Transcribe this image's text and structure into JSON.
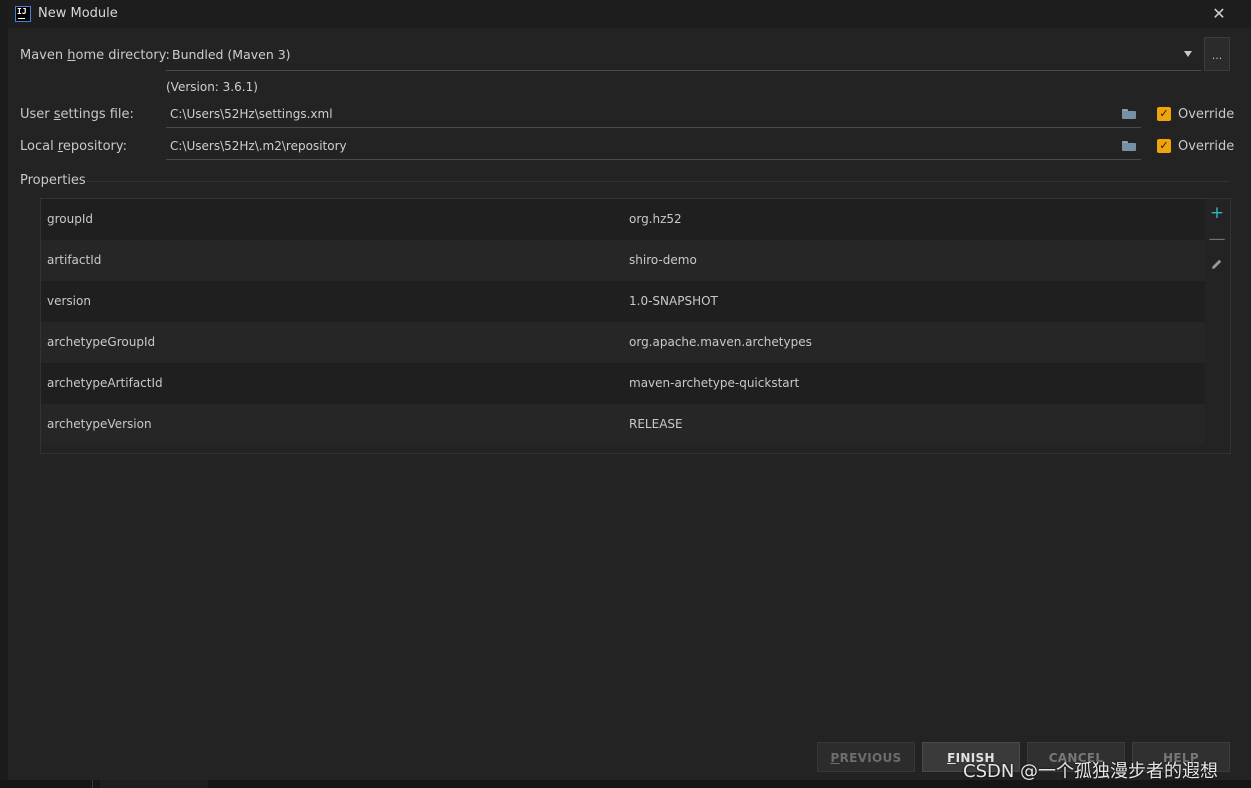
{
  "window": {
    "title": "New Module",
    "app_icon_text": "IJ",
    "close_glyph": "✕"
  },
  "maven": {
    "home_label_pre": "Maven ",
    "home_label_u": "h",
    "home_label_post": "ome directory:",
    "home_value": "Bundled (Maven 3)",
    "browse_label": "...",
    "version_note": "(Version: 3.6.1)",
    "settings_label_pre": "User ",
    "settings_label_u": "s",
    "settings_label_post": "ettings file:",
    "settings_value": "C:\\Users\\52Hz\\settings.xml",
    "settings_override": "Override",
    "repo_label_pre": "Local ",
    "repo_label_u": "r",
    "repo_label_post": "epository:",
    "repo_value": "C:\\Users\\52Hz\\.m2\\repository",
    "repo_override": "Override"
  },
  "properties": {
    "section_label": "Properties",
    "rows": [
      {
        "key": "groupId",
        "value": "org.hz52"
      },
      {
        "key": "artifactId",
        "value": "shiro-demo"
      },
      {
        "key": "version",
        "value": "1.0-SNAPSHOT"
      },
      {
        "key": "archetypeGroupId",
        "value": "org.apache.maven.archetypes"
      },
      {
        "key": "archetypeArtifactId",
        "value": "maven-archetype-quickstart"
      },
      {
        "key": "archetypeVersion",
        "value": "RELEASE"
      }
    ],
    "add_glyph": "+",
    "remove_glyph": "—"
  },
  "buttons": {
    "previous_u": "P",
    "previous_rest": "REVIOUS",
    "finish_u": "F",
    "finish_rest": "INISH",
    "cancel": "CANCEL",
    "help": "HELP"
  },
  "watermark": "CSDN @一个孤独漫步者的遐想",
  "colors": {
    "checkbox": "#f0a30a",
    "add_icon": "#2fb3c8",
    "background": "#232323"
  }
}
